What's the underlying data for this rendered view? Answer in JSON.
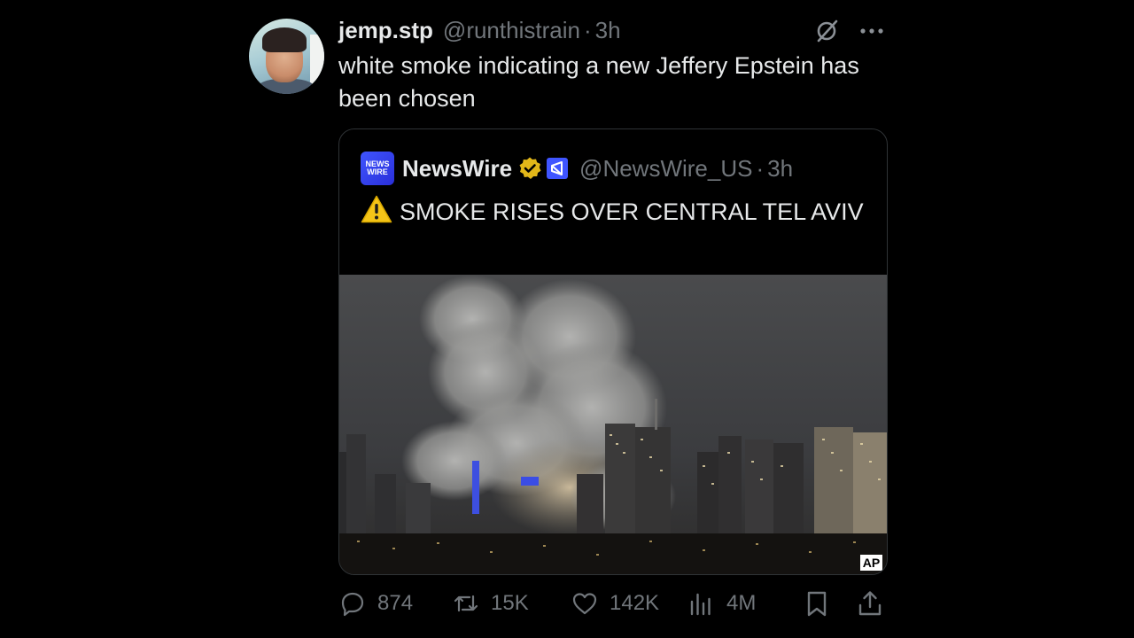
{
  "author": {
    "name": "jemp.stp",
    "handle": "@runthistrain",
    "separator": "·",
    "time": "3h"
  },
  "tweet": {
    "text": "white smoke indicating a new Jeffery Epstein has been chosen"
  },
  "quoted": {
    "logo_line1": "NEWS",
    "logo_line2": "WIRE",
    "name": "NewsWire",
    "handle": "@NewsWire_US",
    "separator": "·",
    "time": "3h",
    "text": "SMOKE RISES OVER CENTRAL TEL AVIV",
    "image_credit": "AP"
  },
  "actions": {
    "replies": "874",
    "retweets": "15K",
    "likes": "142K",
    "views": "4M"
  },
  "icons": [
    "slash-circle-icon",
    "more-icon",
    "verified-badge-icon",
    "affiliate-badge-icon",
    "warning-icon",
    "reply-icon",
    "retweet-icon",
    "like-icon",
    "views-icon",
    "bookmark-icon",
    "share-icon"
  ],
  "colors": {
    "background": "#000000",
    "text": "#e7e9ea",
    "secondary": "#71767b",
    "verified_gold": "#e2b719",
    "brand_blue": "#3f55ff"
  }
}
